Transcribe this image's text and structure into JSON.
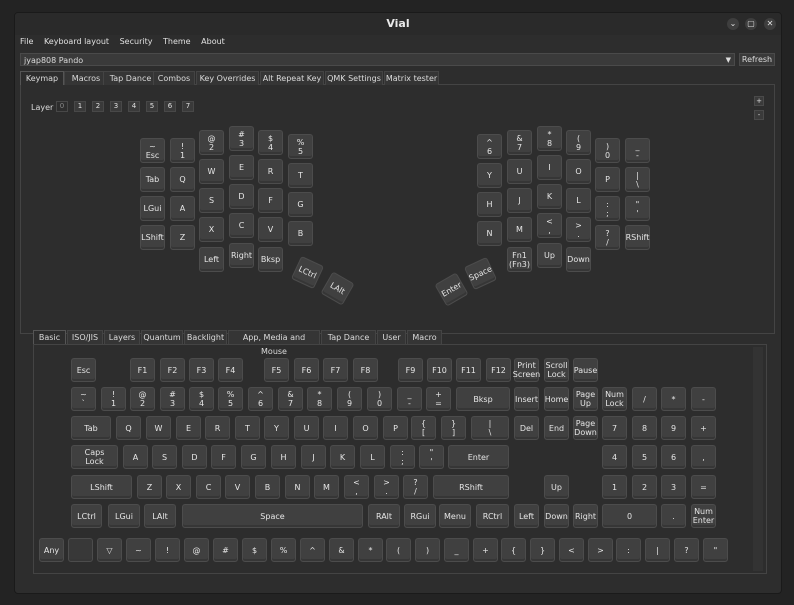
{
  "window": {
    "title": "Vial",
    "buttons": [
      "⌄",
      "▢",
      "✕"
    ]
  },
  "menu": [
    "File",
    "Keyboard layout",
    "Security",
    "Theme",
    "About"
  ],
  "device": {
    "selected": "jyap808 Pando",
    "refresh": "Refresh"
  },
  "tabs": [
    "Keymap",
    "Macros",
    "Tap Dance",
    "Combos",
    "Key Overrides",
    "Alt Repeat Key",
    "QMK Settings",
    "Matrix tester"
  ],
  "layer": {
    "label": "Layer",
    "values": [
      "0",
      "1",
      "2",
      "3",
      "4",
      "5",
      "6",
      "7"
    ],
    "plus": "+",
    "minus": "-"
  },
  "keyboard_keys": [
    "~\nEsc",
    "!\n1",
    "@\n2",
    "#\n3",
    "$\n4",
    "%\n5",
    "Tab",
    "Q",
    "W",
    "E",
    "R",
    "T",
    "LGui",
    "A",
    "S",
    "D",
    "F",
    "G",
    "LShift",
    "Z",
    "X",
    "C",
    "V",
    "B",
    "Left",
    "Right",
    "Bksp",
    "LCtrl",
    "LAlt",
    "^\n6",
    "&\n7",
    "*\n8",
    "(\n9",
    ")\n0",
    "_\n-",
    "Y",
    "U",
    "I",
    "O",
    "P",
    "|\n\\",
    "H",
    "J",
    "K",
    "L",
    ":\n;",
    "\"\n'",
    "N",
    "M",
    "<\n,",
    ">\n.",
    "?\n/",
    "RShift",
    "Fn1\n(Fn3)",
    "Up",
    "Down",
    "Enter",
    "Space"
  ],
  "bottom_tabs": [
    "Basic",
    "ISO/JIS",
    "Layers",
    "Quantum",
    "Backlight",
    "App, Media and Mouse",
    "Tap Dance",
    "User",
    "Macro"
  ],
  "basic_keys": {
    "row0": [
      "Esc",
      "F1",
      "F2",
      "F3",
      "F4",
      "F5",
      "F6",
      "F7",
      "F8",
      "F9",
      "F10",
      "F11",
      "F12",
      "Print\nScreen",
      "Scroll\nLock",
      "Pause"
    ],
    "row1": [
      "~\n`",
      "!\n1",
      "@\n2",
      "#\n3",
      "$\n4",
      "%\n5",
      "^\n6",
      "&\n7",
      "*\n8",
      "(\n9",
      ")\n0",
      "_\n-",
      "+\n=",
      "Bksp",
      "Insert",
      "Home",
      "Page\nUp",
      "Num\nLock",
      "/",
      "*",
      "-"
    ],
    "row2": [
      "Tab",
      "Q",
      "W",
      "E",
      "R",
      "T",
      "Y",
      "U",
      "I",
      "O",
      "P",
      "{\n[",
      "}\n]",
      "|\n\\",
      "Del",
      "End",
      "Page\nDown",
      "7",
      "8",
      "9",
      "+"
    ],
    "row3": [
      "Caps\nLock",
      "A",
      "S",
      "D",
      "F",
      "G",
      "H",
      "J",
      "K",
      "L",
      ":\n;",
      "\"\n'",
      "Enter",
      "4",
      "5",
      "6",
      ","
    ],
    "row4": [
      "LShift",
      "Z",
      "X",
      "C",
      "V",
      "B",
      "N",
      "M",
      "<\n,",
      ">\n.",
      "?\n/",
      "RShift",
      "Up",
      "1",
      "2",
      "3",
      "="
    ],
    "row5": [
      "LCtrl",
      "LGui",
      "LAlt",
      "Space",
      "RAlt",
      "RGui",
      "Menu",
      "RCtrl",
      "Left",
      "Down",
      "Right",
      "0",
      ".",
      "Num\nEnter"
    ],
    "row6": [
      "Any",
      "",
      "▽",
      "~",
      "!",
      "@",
      "#",
      "$",
      "%",
      "^",
      "&",
      "*",
      "(",
      ")",
      "_",
      "+",
      "{",
      "}",
      "<",
      ">",
      ":",
      "|",
      "?",
      "\""
    ]
  }
}
